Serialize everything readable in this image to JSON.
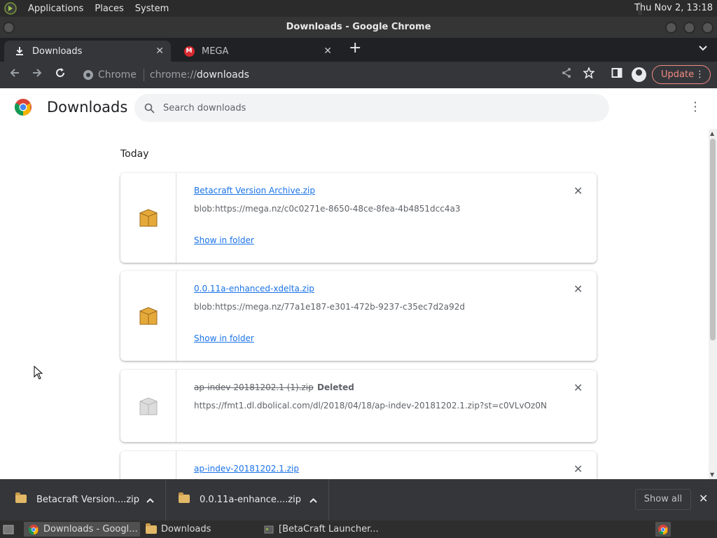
{
  "panel": {
    "menus": [
      "Applications",
      "Places",
      "System"
    ],
    "clock": "Thu Nov  2, 13:18"
  },
  "window": {
    "title": "Downloads - Google Chrome"
  },
  "tabs": [
    {
      "label": "Downloads",
      "icon": "download-icon",
      "active": true
    },
    {
      "label": "MEGA",
      "icon": "mega-icon",
      "active": false
    }
  ],
  "toolbar": {
    "site_label": "Chrome",
    "url_scheme": "chrome://",
    "url_host": "downloads",
    "update_label": "Update"
  },
  "page": {
    "title": "Downloads",
    "search_placeholder": "Search downloads",
    "section_today": "Today",
    "downloads": [
      {
        "filename": "Betacraft Version Archive.zip",
        "source": "blob:https://mega.nz/c0c0271e-8650-48ce-8fea-4b4851dcc4a3",
        "action": "Show in folder",
        "status": "",
        "deleted": false
      },
      {
        "filename": "0.0.11a-enhanced-xdelta.zip",
        "source": "blob:https://mega.nz/77a1e187-e301-472b-9237-c35ec7d2a92d",
        "action": "Show in folder",
        "status": "",
        "deleted": false
      },
      {
        "filename": "ap-indev-20181202.1 (1).zip",
        "source": "https://fmt1.dl.dbolical.com/dl/2018/04/18/ap-indev-20181202.1.zip?st=c0VLvOz0N...",
        "action": "",
        "status": "Deleted",
        "deleted": true
      },
      {
        "filename": "ap-indev-20181202.1.zip",
        "source": "",
        "action": "",
        "status": "",
        "deleted": false
      }
    ]
  },
  "shelf": {
    "items": [
      "Betacraft Version....zip",
      "0.0.11a-enhance....zip"
    ],
    "show_all": "Show all"
  },
  "taskbar": {
    "tasks": [
      "Downloads - Googl...",
      "Downloads",
      "[BetaCraft Launcher..."
    ]
  },
  "colors": {
    "link": "#1a73e8",
    "update_accent": "#f28b82",
    "toolbar_bg": "#35363a"
  }
}
